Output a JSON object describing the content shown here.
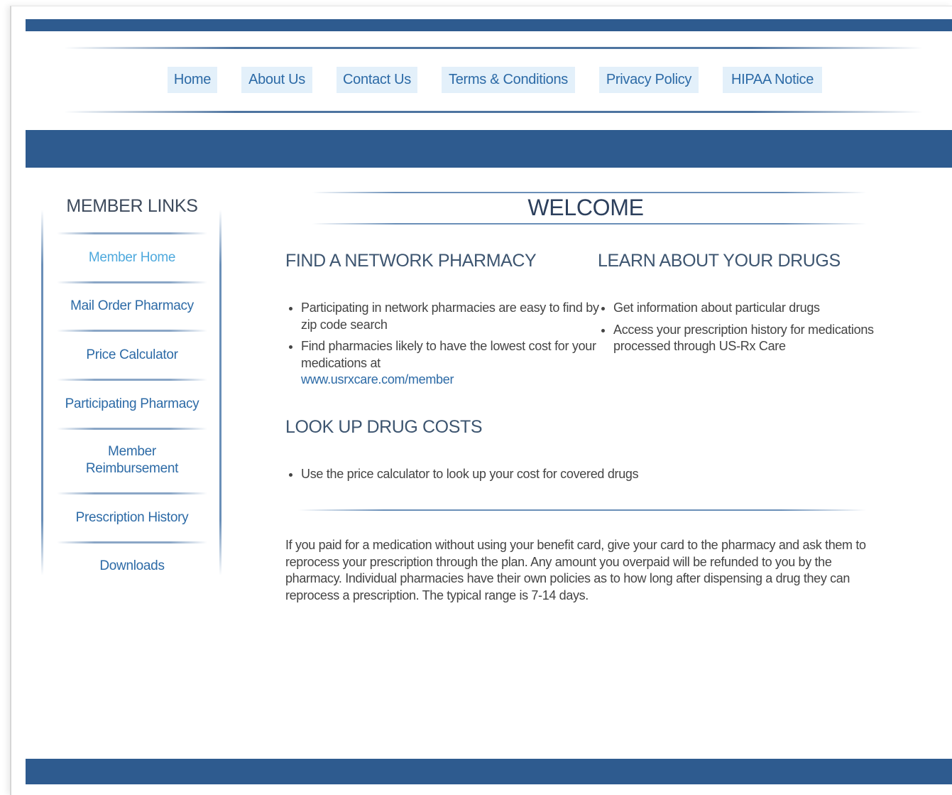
{
  "nav": {
    "items": [
      {
        "label": "Home"
      },
      {
        "label": "About Us"
      },
      {
        "label": "Contact Us"
      },
      {
        "label": "Terms & Conditions"
      },
      {
        "label": "Privacy Policy"
      },
      {
        "label": "HIPAA Notice"
      }
    ]
  },
  "sidebar": {
    "title": "MEMBER LINKS",
    "items": [
      {
        "label": "Member Home"
      },
      {
        "label": "Mail Order Pharmacy"
      },
      {
        "label": "Price Calculator"
      },
      {
        "label": "Participating Pharmacy"
      },
      {
        "label": "Member Reimbursement"
      },
      {
        "label": "Prescription History"
      },
      {
        "label": "Downloads"
      }
    ]
  },
  "main": {
    "title": "WELCOME",
    "find_pharmacy": {
      "heading": "FIND A NETWORK PHARMACY",
      "bullet1": "Participating in network pharmacies are easy to find by zip code search",
      "bullet2": "Find pharmacies likely to have the lowest cost for your medications at",
      "link": "www.usrxcare.com/member"
    },
    "learn_drugs": {
      "heading": "LEARN ABOUT YOUR DRUGS",
      "bullet1": "Get information about particular drugs",
      "bullet2": "Access your prescription history for medications processed through US-Rx Care"
    },
    "drug_costs": {
      "heading": "LOOK UP DRUG COSTS",
      "bullet1": "Use the price calculator to look up your cost for covered drugs"
    },
    "reimbursement_text": "If you paid for a medication without using your benefit card, give your card to the pharmacy and ask them to reprocess your prescription through the plan. Any amount you overpaid will be refunded to you by the pharmacy. Individual pharmacies have their own policies as to how long after dispensing a drug they can reprocess a prescription. The typical range is 7-14 days."
  }
}
